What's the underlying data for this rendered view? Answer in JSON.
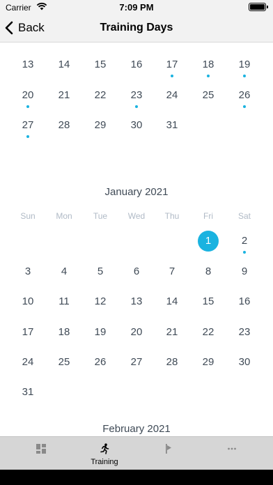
{
  "status_bar": {
    "carrier": "Carrier",
    "time": "7:09 PM"
  },
  "nav": {
    "back_label": "Back",
    "title": "Training Days"
  },
  "weekdays": [
    "Sun",
    "Mon",
    "Tue",
    "Wed",
    "Thu",
    "Fri",
    "Sat"
  ],
  "december_partial": {
    "rows": [
      [
        {
          "d": "13",
          "dot": false
        },
        {
          "d": "14",
          "dot": false
        },
        {
          "d": "15",
          "dot": false
        },
        {
          "d": "16",
          "dot": false
        },
        {
          "d": "17",
          "dot": true
        },
        {
          "d": "18",
          "dot": true
        },
        {
          "d": "19",
          "dot": true
        }
      ],
      [
        {
          "d": "20",
          "dot": true
        },
        {
          "d": "21",
          "dot": false
        },
        {
          "d": "22",
          "dot": false
        },
        {
          "d": "23",
          "dot": true
        },
        {
          "d": "24",
          "dot": false
        },
        {
          "d": "25",
          "dot": false
        },
        {
          "d": "26",
          "dot": true
        }
      ],
      [
        {
          "d": "27",
          "dot": true
        },
        {
          "d": "28",
          "dot": false
        },
        {
          "d": "29",
          "dot": false
        },
        {
          "d": "30",
          "dot": false
        },
        {
          "d": "31",
          "dot": false
        }
      ]
    ]
  },
  "january": {
    "title": "January 2021",
    "first_weekday": 5,
    "selected": "1",
    "days": [
      {
        "d": "1",
        "dot": false
      },
      {
        "d": "2",
        "dot": true
      },
      {
        "d": "3",
        "dot": false
      },
      {
        "d": "4",
        "dot": false
      },
      {
        "d": "5",
        "dot": false
      },
      {
        "d": "6",
        "dot": false
      },
      {
        "d": "7",
        "dot": false
      },
      {
        "d": "8",
        "dot": false
      },
      {
        "d": "9",
        "dot": false
      },
      {
        "d": "10",
        "dot": false
      },
      {
        "d": "11",
        "dot": false
      },
      {
        "d": "12",
        "dot": false
      },
      {
        "d": "13",
        "dot": false
      },
      {
        "d": "14",
        "dot": false
      },
      {
        "d": "15",
        "dot": false
      },
      {
        "d": "16",
        "dot": false
      },
      {
        "d": "17",
        "dot": false
      },
      {
        "d": "18",
        "dot": false
      },
      {
        "d": "19",
        "dot": false
      },
      {
        "d": "20",
        "dot": false
      },
      {
        "d": "21",
        "dot": false
      },
      {
        "d": "22",
        "dot": false
      },
      {
        "d": "23",
        "dot": false
      },
      {
        "d": "24",
        "dot": false
      },
      {
        "d": "25",
        "dot": false
      },
      {
        "d": "26",
        "dot": false
      },
      {
        "d": "27",
        "dot": false
      },
      {
        "d": "28",
        "dot": false
      },
      {
        "d": "29",
        "dot": false
      },
      {
        "d": "30",
        "dot": false
      },
      {
        "d": "31",
        "dot": false
      }
    ]
  },
  "february": {
    "title": "February 2021"
  },
  "tabs": [
    {
      "label": "",
      "icon": "dashboard-icon",
      "active": false
    },
    {
      "label": "Training",
      "icon": "running-icon",
      "active": true
    },
    {
      "label": "",
      "icon": "flag-icon",
      "active": false
    },
    {
      "label": "",
      "icon": "more-icon",
      "active": false
    }
  ],
  "colors": {
    "accent": "#1ab3e0",
    "text": "#3f4a56",
    "weekday": "#b0bac6",
    "tabbar": "#d6d6d6"
  }
}
